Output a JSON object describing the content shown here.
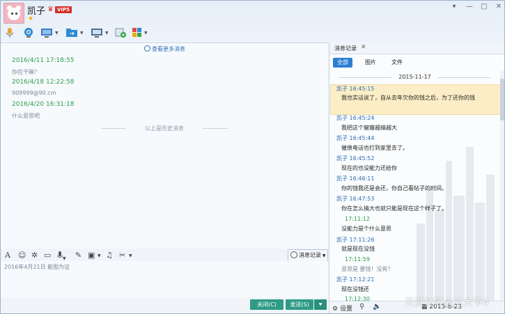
{
  "contact": {
    "name": "凯子",
    "vip_label": "VIP5",
    "star": "★"
  },
  "window_controls": {
    "menu": "▾",
    "minimize": "—",
    "maximize": "□",
    "close": "✕"
  },
  "toolbar": {
    "icons": [
      "microphone-icon",
      "video-camera-icon",
      "screen-share-icon",
      "file-transfer-icon",
      "remote-desktop-icon",
      "create-group-icon",
      "apps-icon"
    ]
  },
  "chat": {
    "more_messages": "查看更多消息",
    "history": [
      {
        "time": "2016/4/11 17:18:55",
        "text": "你在干嘛？"
      },
      {
        "time": "2016/4/18 12:22:58",
        "text": "909999@90.cm"
      },
      {
        "time": "2016/4/20 16:31:18",
        "text": "什么意思吧"
      }
    ],
    "history_separator": "以上是历史消息"
  },
  "input_toolbar": {
    "font": "A",
    "emoji": "☺",
    "shake": "✲",
    "screenshot": "▭",
    "voice": "🎤",
    "edit": "✎",
    "image": "▣",
    "music": "♫",
    "scissors": "✂",
    "history_button": "消息记录"
  },
  "input": {
    "text": "2016年4月21日 能图为证"
  },
  "buttons": {
    "close": "关闭(C)",
    "send": "发送(S)",
    "send_menu": "▼"
  },
  "records": {
    "title": "消息记录",
    "filters": [
      "全部",
      "图片",
      "文件"
    ],
    "date": "2015-11-17",
    "messages": [
      {
        "time": "凯子 16:45:15",
        "text": "我也实话说了，自从去年欠你的钱之后，为了还你的钱"
      },
      {
        "time": "凯子 16:45:24",
        "text": "我把这个窟窿越搞越大"
      },
      {
        "time": "凯子 16:45:44",
        "text": "催债电话也打到家里去了。"
      },
      {
        "time": "凯子 16:45:52",
        "text": "现在的也没能力还给你"
      },
      {
        "time": "凯子 16:46:11",
        "text": "你的钱我还是会还，你自己看帖子的时间。"
      },
      {
        "time": "凯子 16:47:53",
        "text": "你在怎么搞大也就只能是现在这个样子了。"
      },
      {
        "time": "17:11:12",
        "text": "没能力是个什么意思"
      },
      {
        "time": "凯子 17:11:26",
        "text": "就是现在没钱"
      },
      {
        "time": "17:11:59",
        "text": "意思是 要钱！没有？"
      },
      {
        "time": "凯子 17:12:21",
        "text": "现在没钱还"
      },
      {
        "time": "17:12:30",
        "text": ""
      }
    ],
    "bottom": {
      "settings": "设置",
      "date": "2015-8-23"
    }
  },
  "watermark": "天涯社区@三大爷4"
}
